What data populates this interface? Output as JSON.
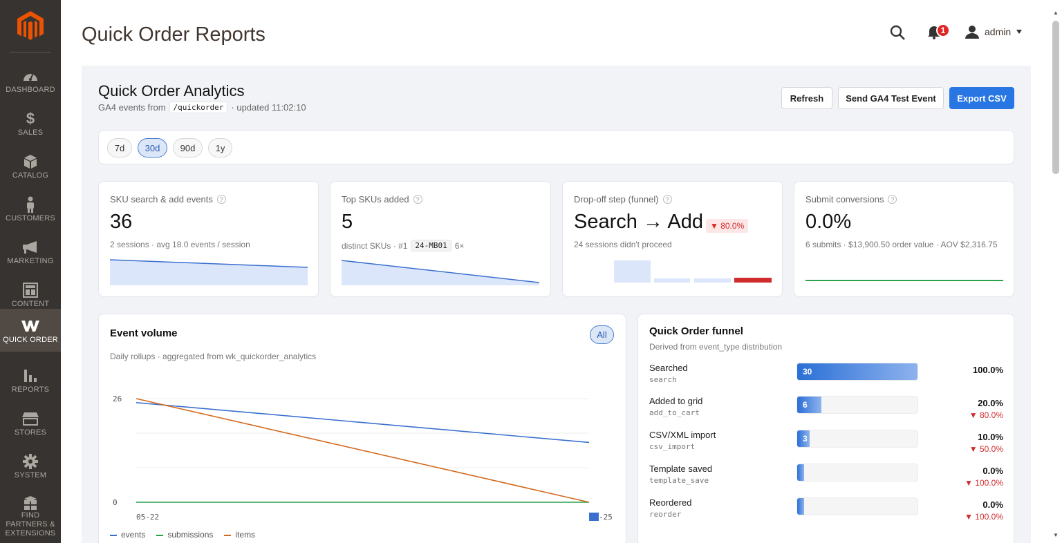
{
  "sidebar": {
    "items": [
      {
        "label": "DASHBOARD",
        "icon": "dashboard-icon"
      },
      {
        "label": "SALES",
        "icon": "dollar-icon"
      },
      {
        "label": "CATALOG",
        "icon": "box-icon"
      },
      {
        "label": "CUSTOMERS",
        "icon": "person-icon"
      },
      {
        "label": "MARKETING",
        "icon": "megaphone-icon"
      },
      {
        "label": "CONTENT",
        "icon": "layout-icon"
      },
      {
        "label": "QUICK ORDER",
        "icon": "w-logo-icon"
      },
      {
        "label": "REPORTS",
        "icon": "bar-chart-icon"
      },
      {
        "label": "STORES",
        "icon": "store-icon"
      },
      {
        "label": "SYSTEM",
        "icon": "gear-icon"
      },
      {
        "label": "FIND PARTNERS & EXTENSIONS",
        "icon": "cubes-icon"
      }
    ]
  },
  "header": {
    "title": "Quick Order Reports",
    "notifications": "1",
    "user": "admin"
  },
  "analytics": {
    "title": "Quick Order Analytics",
    "sub_prefix": "GA4 events from",
    "sub_path": "/quickorder",
    "sub_updated": "· updated 11:02:10",
    "buttons": {
      "refresh": "Refresh",
      "send": "Send GA4 Test Event",
      "export": "Export CSV"
    }
  },
  "ranges": [
    "7d",
    "30d",
    "90d",
    "1y"
  ],
  "kpis": {
    "search": {
      "label": "SKU search & add events",
      "value": "36",
      "sub": "2 sessions · avg 18.0 events / session"
    },
    "skus": {
      "label": "Top SKUs added",
      "value": "5",
      "sub_prefix": "distinct SKUs · #1",
      "sub_sku": "24-MB01",
      "sub_suffix": "6×"
    },
    "dropoff": {
      "label": "Drop-off step (funnel)",
      "value": "Search → Add",
      "badge": "▼ 80.0%",
      "sub": "24 sessions didn't proceed"
    },
    "submit": {
      "label": "Submit conversions",
      "value": "0.0%",
      "sub": "6 submits · $13,900.50 order value · AOV $2,316.75"
    }
  },
  "event_volume": {
    "title": "Event volume",
    "sub": "Daily rollups · aggregated from wk_quickorder_analytics",
    "filter": "All"
  },
  "chart_data": {
    "type": "line",
    "x": [
      "05-22",
      "06-25"
    ],
    "series": [
      {
        "name": "events",
        "values": [
          25,
          15
        ],
        "color": "#3a6fcf"
      },
      {
        "name": "submissions",
        "values": [
          0,
          0
        ],
        "color": "#2aa14a"
      },
      {
        "name": "items",
        "values": [
          26,
          0
        ],
        "color": "#d2691e"
      }
    ],
    "yticks": [
      "26",
      "0"
    ],
    "xtick_left": "05-22",
    "xtick_right": "-25",
    "ylim": [
      0,
      26
    ]
  },
  "funnel": {
    "title": "Quick Order funnel",
    "sub": "Derived from event_type distribution",
    "rows": [
      {
        "name": "Searched",
        "code": "search",
        "count": "30",
        "fraction": 1.0,
        "pct": "100.0%",
        "drop": ""
      },
      {
        "name": "Added to grid",
        "code": "add_to_cart",
        "count": "6",
        "fraction": 0.2,
        "pct": "20.0%",
        "drop": "▼ 80.0%"
      },
      {
        "name": "CSV/XML import",
        "code": "csv_import",
        "count": "3",
        "fraction": 0.1,
        "pct": "10.0%",
        "drop": "▼ 50.0%"
      },
      {
        "name": "Template saved",
        "code": "template_save",
        "count": "",
        "fraction": 0.0,
        "pct": "0.0%",
        "drop": "▼ 100.0%"
      },
      {
        "name": "Reordered",
        "code": "reorder",
        "count": "",
        "fraction": 0.0,
        "pct": "0.0%",
        "drop": "▼ 100.0%"
      }
    ]
  }
}
